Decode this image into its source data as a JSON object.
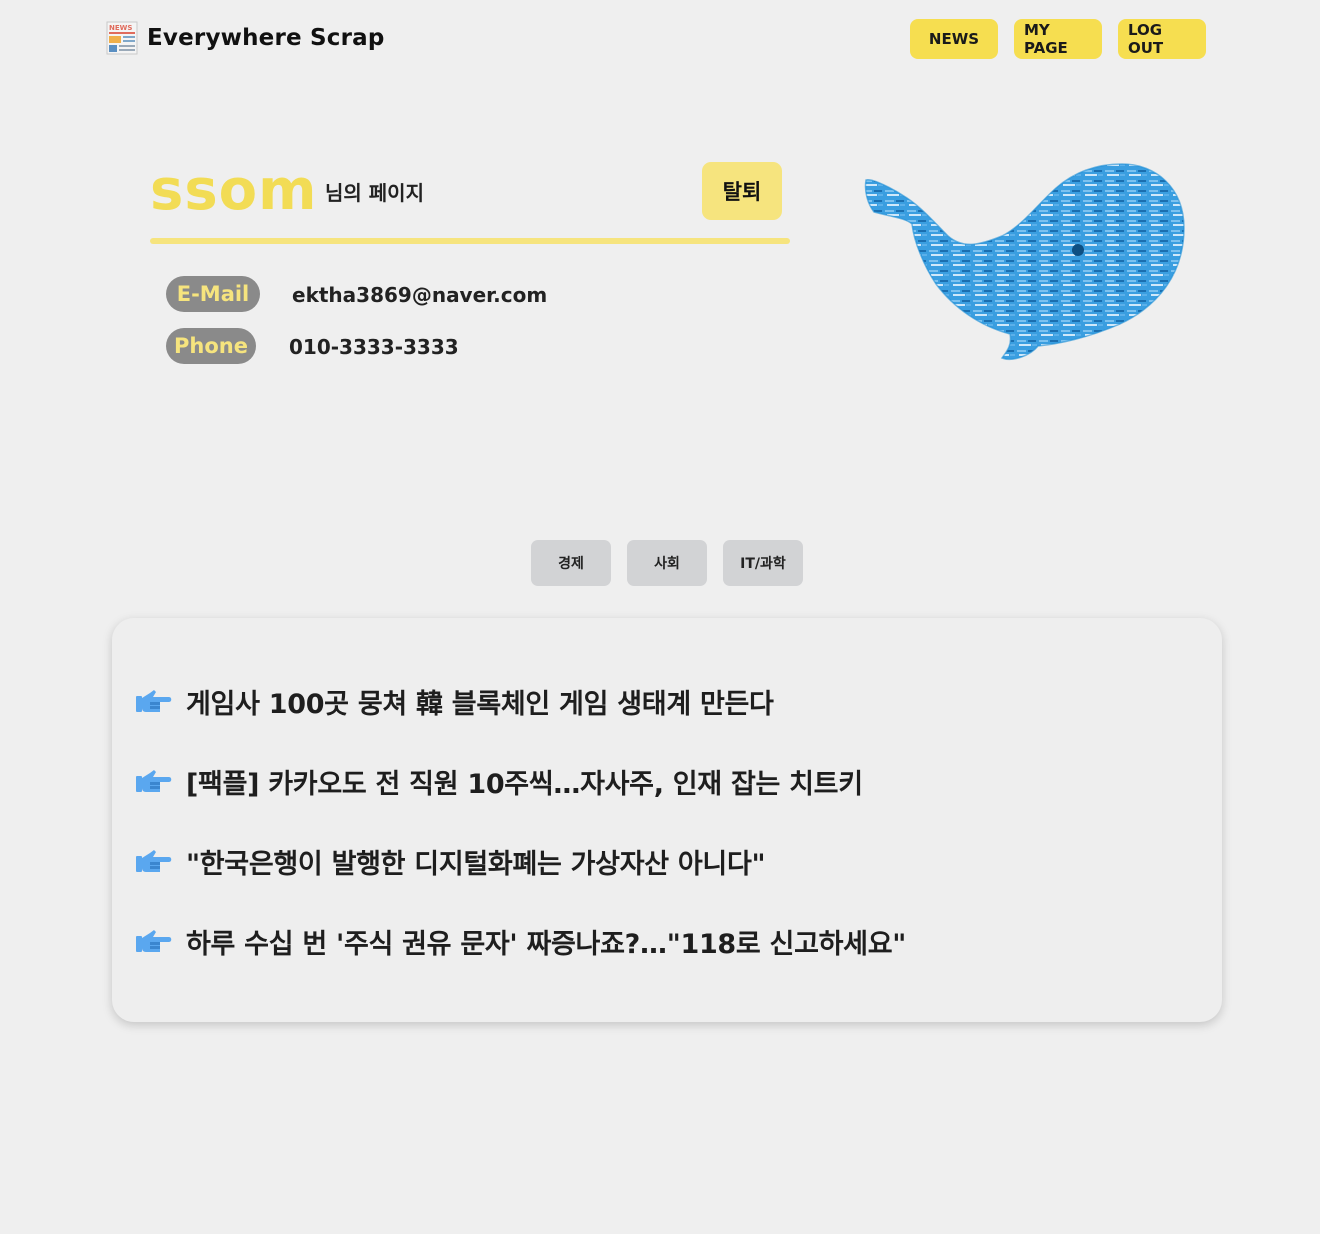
{
  "header": {
    "title": "Everywhere Scrap",
    "logo_icon": "newspaper-icon",
    "logo_text": "NEWS",
    "nav": [
      "NEWS",
      "MY PAGE",
      "LOG OUT"
    ]
  },
  "profile": {
    "name": "ssom",
    "suffix": "님의 페이지",
    "withdraw_label": "탈퇴",
    "email_label": "E-Mail",
    "email": "ektha3869@naver.com",
    "phone_label": "Phone",
    "phone": "010-3333-3333",
    "illustration": "whale-word-cloud-image"
  },
  "categories": [
    "경제",
    "사회",
    "IT/과학"
  ],
  "news": {
    "bullet_icon": "pointing-hand-icon",
    "items": [
      "게임사 100곳 뭉쳐 韓 블록체인 게임 생태계 만든다",
      "[팩플] 카카오도 전 직원 10주씩…자사주, 인재 잡는 치트키",
      "\"한국은행이 발행한 디지털화폐는 가상자산 아니다\"",
      "하루 수십 번 '주식 권유 문자' 짜증나죠?…\"118로 신고하세요\""
    ]
  },
  "colors": {
    "background": "#efefef",
    "accent_yellow": "#f6de50",
    "soft_yellow": "#f6e47e",
    "label_gray": "#8a8a8a",
    "tab_gray": "#d2d3d5",
    "whale_blue": "#1f8fd6",
    "hand_blue": "#5aa7ef"
  }
}
